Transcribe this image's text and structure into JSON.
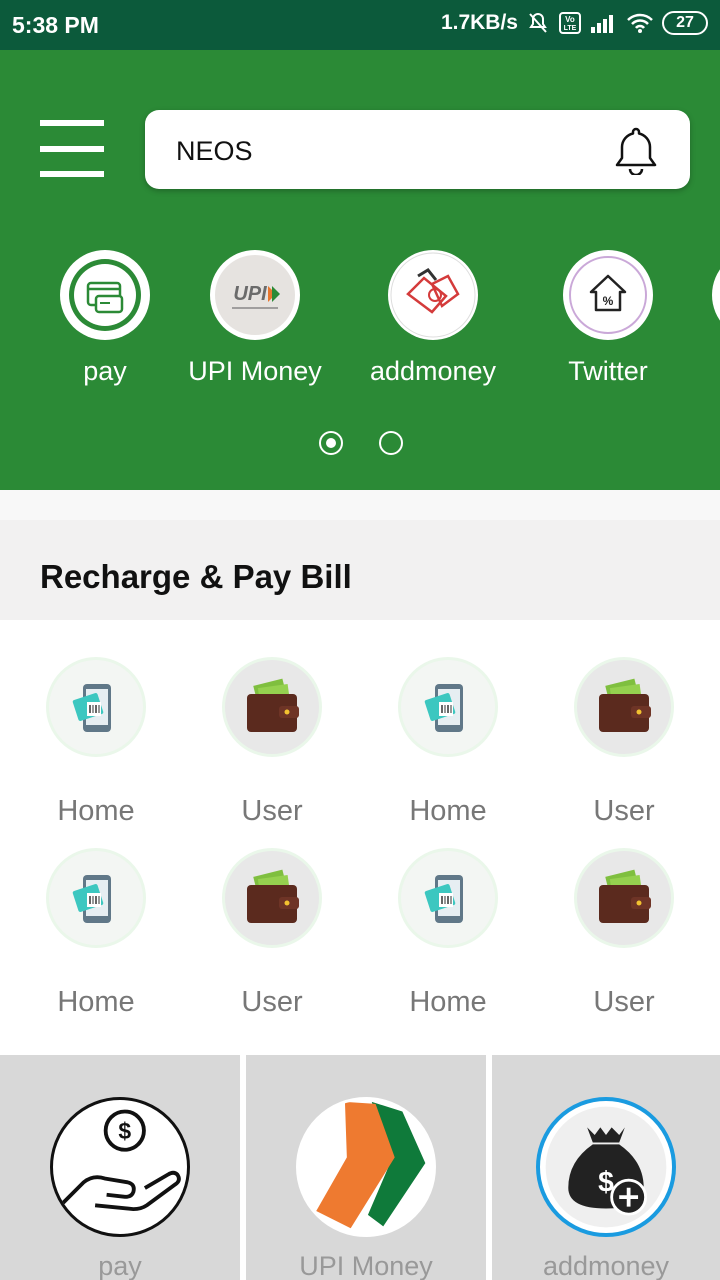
{
  "status_bar": {
    "time": "5:38 PM",
    "network_speed": "1.7KB/s",
    "volte": "Vo LTE",
    "battery": "27"
  },
  "header": {
    "search_title": "NEOS"
  },
  "quick_actions": [
    {
      "label": "pay",
      "icon": "card-payment-icon"
    },
    {
      "label": "UPI Money",
      "icon": "upi-logo-icon"
    },
    {
      "label": "addmoney",
      "icon": "handshake-icon"
    },
    {
      "label": "Twitter",
      "icon": "house-percent-icon"
    }
  ],
  "carousel": {
    "pages": 2,
    "active": 0
  },
  "section": {
    "title": "Recharge & Pay Bill"
  },
  "grid_items": [
    {
      "label": "Home",
      "icon": "mobile-bill-icon"
    },
    {
      "label": "User",
      "icon": "wallet-icon"
    },
    {
      "label": "Home",
      "icon": "mobile-bill-icon"
    },
    {
      "label": "User",
      "icon": "wallet-icon"
    },
    {
      "label": "Home",
      "icon": "mobile-bill-icon"
    },
    {
      "label": "User",
      "icon": "wallet-icon"
    },
    {
      "label": "Home",
      "icon": "mobile-bill-icon"
    },
    {
      "label": "User",
      "icon": "wallet-icon"
    }
  ],
  "bottom_cards": [
    {
      "label": "pay",
      "icon": "hand-dollar-icon"
    },
    {
      "label": "UPI Money",
      "icon": "upi-arrow-icon"
    },
    {
      "label": "addmoney",
      "icon": "money-bag-add-icon"
    }
  ],
  "colors": {
    "status_bar": "#0c5a3b",
    "header": "#2b8a36",
    "section_bg": "#f2f1f1",
    "card_bg": "#d8d8d8"
  }
}
